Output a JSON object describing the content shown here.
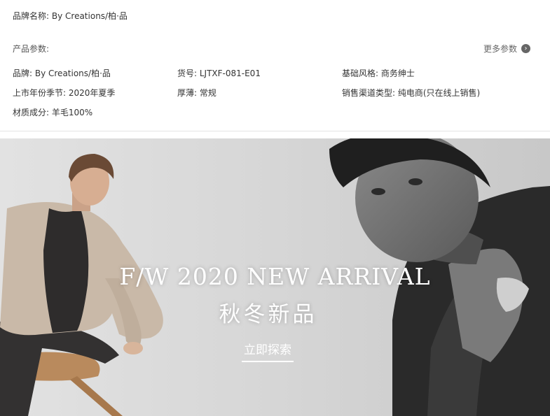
{
  "product": {
    "brand_name_label": "品牌名称:",
    "brand_name_value": "By Creations/柏·品"
  },
  "params": {
    "title": "产品参数:",
    "more_label": "更多参数",
    "more_icon": "chevron-right-circle-icon",
    "items": [
      "品牌: By Creations/柏·品",
      "货号: LJTXF-081-E01",
      "基础风格: 商务绅士",
      "上市年份季节: 2020年夏季",
      "厚薄: 常规",
      "销售渠道类型: 纯电商(只在线上销售)",
      "材质成分: 羊毛100%"
    ]
  },
  "banner": {
    "headline_en": "F/W 2020 NEW ARRIVAL",
    "headline_cn": "秋冬新品",
    "cta_label": "立即探索",
    "colors": {
      "background": "#dcdcdc",
      "blazer": "#c9b9a8",
      "sweater": "#2e2c2c",
      "chair": "#b98a5d",
      "dark_coat": "#2a2a2a"
    }
  }
}
